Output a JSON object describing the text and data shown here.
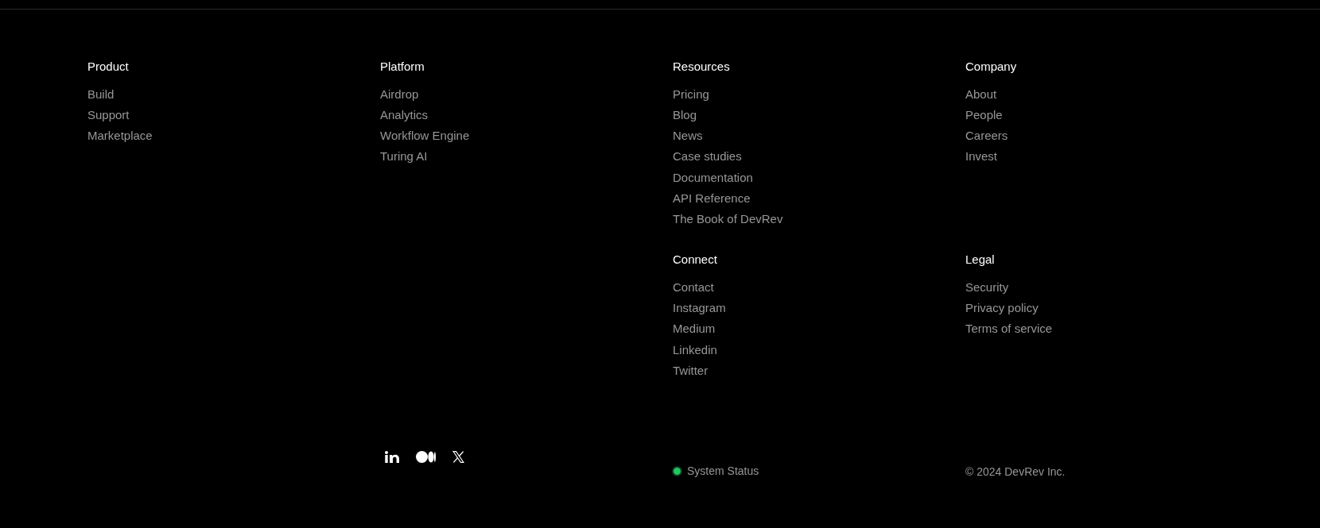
{
  "footer": {
    "columns": [
      {
        "sections": [
          {
            "heading": "Product",
            "links": [
              "Build",
              "Support",
              "Marketplace"
            ]
          }
        ]
      },
      {
        "sections": [
          {
            "heading": "Platform",
            "links": [
              "Airdrop",
              "Analytics",
              "Workflow Engine",
              "Turing AI"
            ]
          }
        ]
      },
      {
        "sections": [
          {
            "heading": "Resources",
            "links": [
              "Pricing",
              "Blog",
              "News",
              "Case studies",
              "Documentation",
              "API Reference",
              "The Book of DevRev"
            ]
          },
          {
            "heading": "Connect",
            "links": [
              "Contact",
              "Instagram",
              "Medium",
              "Linkedin",
              "Twitter"
            ]
          }
        ]
      },
      {
        "sections": [
          {
            "heading": "Company",
            "links": [
              "About",
              "People",
              "Careers",
              "Invest"
            ]
          },
          {
            "heading": "Legal",
            "links": [
              "Security",
              "Privacy policy",
              "Terms of service"
            ]
          }
        ]
      }
    ],
    "social_links": [
      {
        "kind": "linkedin"
      },
      {
        "kind": "medium"
      },
      {
        "kind": "x"
      }
    ],
    "system_status": {
      "label": "System Status",
      "color": "#22c55e"
    },
    "copyright": "© 2024 DevRev Inc."
  }
}
